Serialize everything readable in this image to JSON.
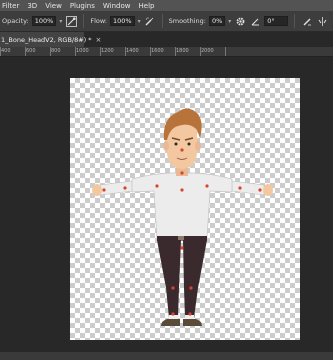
{
  "menubar": {
    "items": [
      "Filter",
      "3D",
      "View",
      "Plugins",
      "Window",
      "Help"
    ]
  },
  "options_bar": {
    "opacity_label": "Opacity:",
    "opacity_value": "100%",
    "flow_label": "Flow:",
    "flow_value": "100%",
    "smoothing_label": "Smoothing:",
    "smoothing_value": "0%",
    "angle_value": "0°"
  },
  "document_tab": {
    "title": "1_Bone_HeadV2, RGB/8#) *",
    "close": "×"
  },
  "ruler": {
    "ticks": [
      "400",
      "600",
      "800",
      "1000",
      "1200",
      "1400",
      "1600",
      "1800",
      "2000"
    ]
  },
  "colors": {
    "ui_dark": "#282828",
    "panel": "#3d3d3d",
    "menubar": "#535353",
    "skin": "#f3c8a0",
    "hair": "#b8733a",
    "shirt": "#ececec",
    "pants": "#3a2a2e",
    "bone_marker": "#d9442e"
  }
}
